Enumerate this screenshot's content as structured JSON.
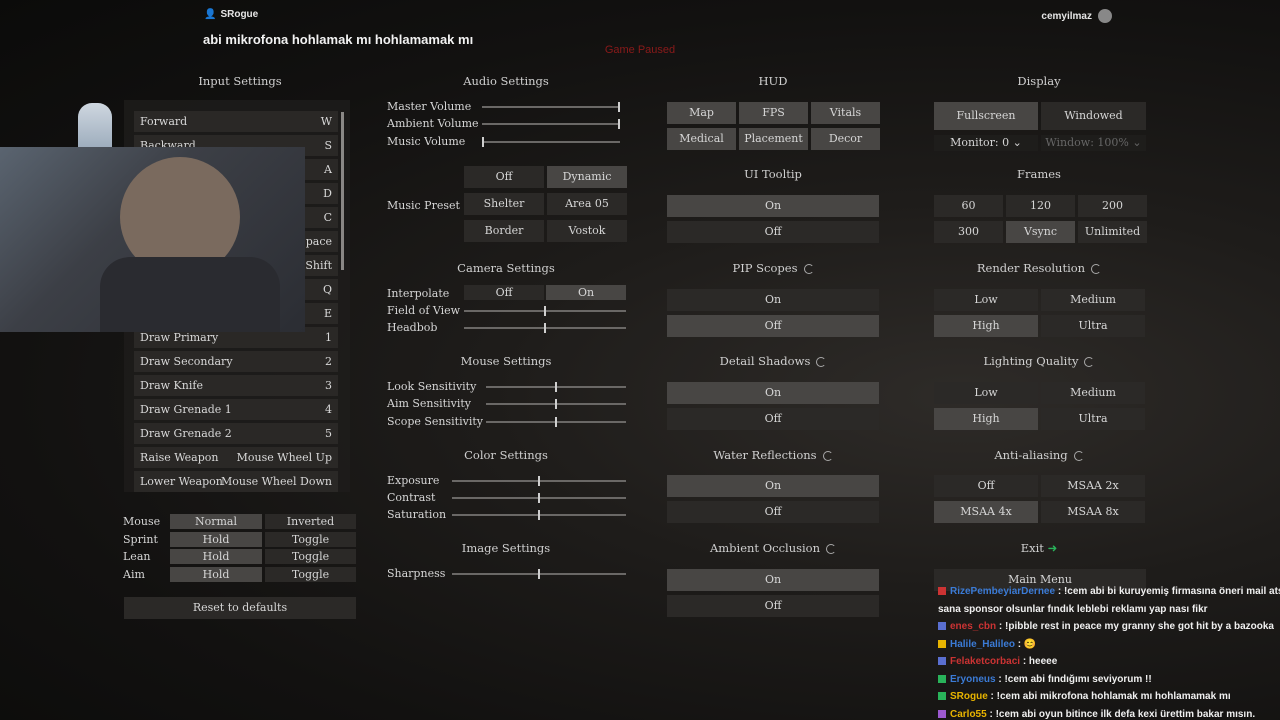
{
  "topbar": {
    "user": "SRogue",
    "right_user": "cemyilmaz",
    "title": "abi mikrofona hohlamak mı hohlamamak mı"
  },
  "status": "Game Paused",
  "input_settings": {
    "title": "Input Settings",
    "bindings": [
      {
        "action": "Forward",
        "key": "W"
      },
      {
        "action": "Backward",
        "key": "S"
      },
      {
        "action": "",
        "key": "A"
      },
      {
        "action": "",
        "key": "D"
      },
      {
        "action": "",
        "key": "C"
      },
      {
        "action": "",
        "key": "Space"
      },
      {
        "action": "",
        "key": "Shift"
      },
      {
        "action": "",
        "key": "Q"
      },
      {
        "action": "",
        "key": "E"
      },
      {
        "action": "Draw Primary",
        "key": "1"
      },
      {
        "action": "Draw Secondary",
        "key": "2"
      },
      {
        "action": "Draw Knife",
        "key": "3"
      },
      {
        "action": "Draw Grenade 1",
        "key": "4"
      },
      {
        "action": "Draw Grenade 2",
        "key": "5"
      },
      {
        "action": "Raise Weapon",
        "key": "Mouse Wheel Up"
      },
      {
        "action": "Lower Weapon",
        "key": "Mouse Wheel Down"
      }
    ],
    "toggles": [
      {
        "label": "Mouse",
        "a": "Normal",
        "b": "Inverted",
        "sel": "a"
      },
      {
        "label": "Sprint",
        "a": "Hold",
        "b": "Toggle",
        "sel": "a"
      },
      {
        "label": "Lean",
        "a": "Hold",
        "b": "Toggle",
        "sel": "a"
      },
      {
        "label": "Aim",
        "a": "Hold",
        "b": "Toggle",
        "sel": "a"
      }
    ],
    "reset": "Reset to defaults"
  },
  "audio": {
    "title": "Audio Settings",
    "master": "Master Volume",
    "master_v": 1.0,
    "ambient": "Ambient Volume",
    "ambient_v": 1.0,
    "music": "Music Volume",
    "music_v": 0.0,
    "preset_label": "Music Preset",
    "presets": [
      "Off",
      "Dynamic",
      "Shelter",
      "Area 05",
      "Border",
      "Vostok"
    ],
    "preset_sel": "Dynamic"
  },
  "camera": {
    "title": "Camera Settings",
    "interpolate": "Interpolate",
    "off": "Off",
    "on": "On",
    "fov": "Field of View",
    "fov_v": 0.5,
    "headbob": "Headbob",
    "headbob_v": 0.5
  },
  "mouse": {
    "title": "Mouse Settings",
    "look": "Look Sensitivity",
    "look_v": 0.5,
    "aim": "Aim Sensitivity",
    "aim_v": 0.5,
    "scope": "Scope Sensitivity",
    "scope_v": 0.5
  },
  "color": {
    "title": "Color Settings",
    "exposure": "Exposure",
    "exposure_v": 0.5,
    "contrast": "Contrast",
    "contrast_v": 0.5,
    "saturation": "Saturation",
    "saturation_v": 0.5
  },
  "image": {
    "title": "Image Settings",
    "sharpness": "Sharpness",
    "sharpness_v": 0.5
  },
  "hud": {
    "title": "HUD",
    "buttons": [
      "Map",
      "FPS",
      "Vitals",
      "Medical",
      "Placement",
      "Decor"
    ],
    "tooltip_title": "UI Tooltip",
    "pip_title": "PIP Scopes",
    "shadows_title": "Detail Shadows",
    "water_title": "Water Reflections",
    "ao_title": "Ambient Occlusion",
    "on": "On",
    "off": "Off"
  },
  "display": {
    "title": "Display",
    "fullscreen": "Fullscreen",
    "windowed": "Windowed",
    "monitor": "Monitor: 0",
    "window": "Window: 100%",
    "frames_title": "Frames",
    "frames": [
      "60",
      "120",
      "200",
      "300",
      "Vsync",
      "Unlimited"
    ],
    "frames_sel": "Vsync",
    "render_title": "Render Resolution",
    "lighting_title": "Lighting Quality",
    "quality": [
      "Low",
      "Medium",
      "High",
      "Ultra"
    ],
    "quality_sel": "High",
    "aa_title": "Anti-aliasing",
    "aa": [
      "Off",
      "MSAA 2x",
      "MSAA 4x",
      "MSAA 8x"
    ],
    "aa_sel": "MSAA 4x",
    "exit": "Exit",
    "main_menu": "Main Menu"
  },
  "chat": [
    {
      "user": "RizePembeyiarDernee",
      "msg": ": !cem abi bi kuruyemiş firmasına öneri mail atsın",
      "color": "#3b7bd6",
      "badge": "#c33"
    },
    {
      "user": "",
      "msg": "sana sponsor olsunlar fındık leblebi reklamı yap nası fikr",
      "color": "#ffffff",
      "badge": ""
    },
    {
      "user": "enes_cbn",
      "msg": ": !pibble rest in peace my granny she got hit by a bazooka",
      "color": "#c33",
      "badge": "#5a6fd0"
    },
    {
      "user": "Halile_Halileo",
      "msg": ": 😊",
      "color": "#3b7bd6",
      "badge": "#e8b400"
    },
    {
      "user": "Felaketcorbaci",
      "msg": ": heeee",
      "color": "#c33",
      "badge": "#5a6fd0"
    },
    {
      "user": "Eryoneus",
      "msg": ": !cem abi fındığımı seviyorum !!",
      "color": "#3b7bd6",
      "badge": "#29b35a"
    },
    {
      "user": "SRogue",
      "msg": ": !cem abi mikrofona hohlamak mı hohlamamak mı",
      "color": "#e8b400",
      "badge": "#29b35a"
    },
    {
      "user": "Carlo55",
      "msg": ": !cem abi oyun bitince ilk defa kexi ürettim bakar mısın.",
      "color": "#e8b400",
      "badge": "#9b59d0"
    }
  ]
}
